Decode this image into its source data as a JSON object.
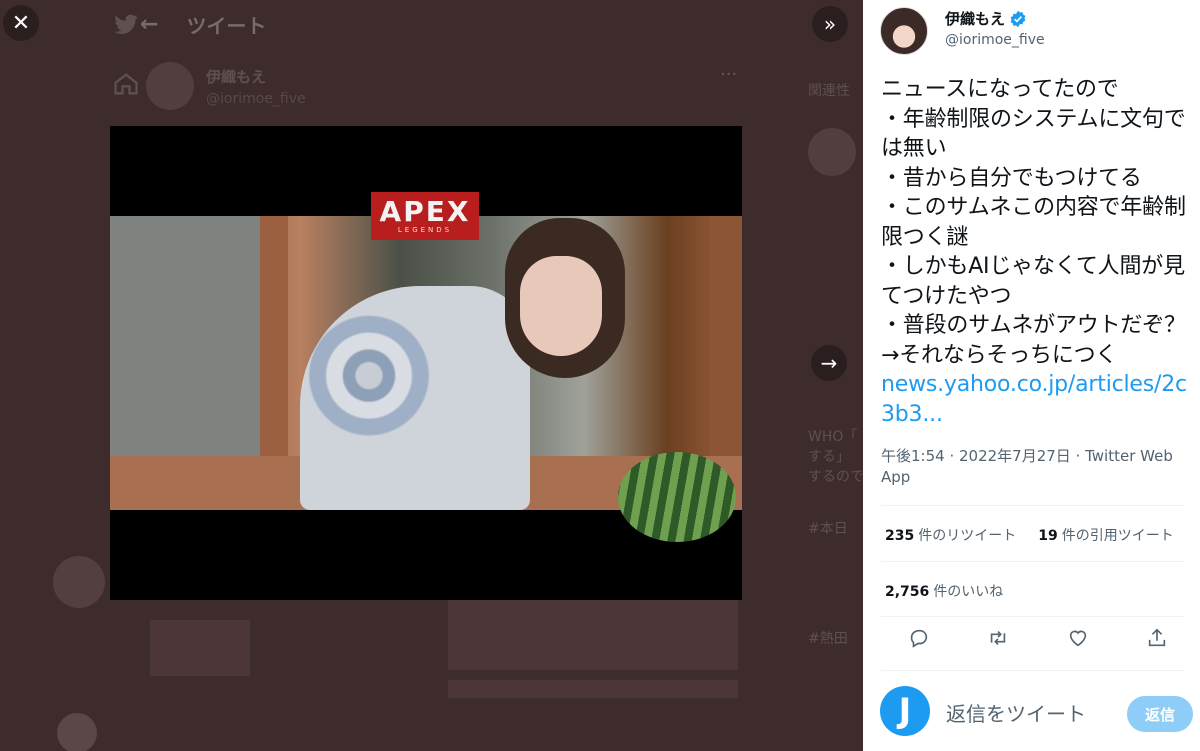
{
  "background": {
    "header_title": "ツイート",
    "author_name": "伊織もえ",
    "author_handle": "@iorimoe_five",
    "right_labels": [
      "関連性",
      "WHO「",
      "する」",
      "するので",
      "#本日",
      "#熱田"
    ]
  },
  "media": {
    "logo_text": "APEX",
    "logo_sub": "LEGENDS"
  },
  "tweet": {
    "author": "伊織もえ",
    "handle": "@iorimoe_five",
    "text": "ニュースになってたので\n・年齢制限のシステムに文句では無い\n・昔から自分でもつけてる\n・このサムネこの内容で年齢制限つく謎\n・しかもAIじゃなくて人間が見てつけたやつ\n・普段のサムネがアウトだぞ？→それならそっちにつく\n",
    "link": "news.yahoo.co.jp/articles/2c3b3...",
    "meta": "午後1:54 · 2022年7月27日 · Twitter Web App",
    "retweets_count": "235",
    "retweets_label": "件のリツイート",
    "quotes_count": "19",
    "quotes_label": "件の引用ツイート",
    "likes_count": "2,756",
    "likes_label": "件のいいね"
  },
  "reply": {
    "avatar_letter": "J",
    "placeholder": "返信をツイート",
    "button_label": "返信"
  },
  "colors": {
    "accent": "#1d9bf0",
    "overlay": "#3e2c2d",
    "apex_red": "#b81e1e"
  },
  "icons": {
    "close": "close-icon",
    "collapse": "double-chevron-right-icon",
    "next": "arrow-right-icon",
    "verified": "verified-badge-icon",
    "reply": "reply-icon",
    "retweet": "retweet-icon",
    "like": "heart-icon",
    "share": "share-icon"
  }
}
